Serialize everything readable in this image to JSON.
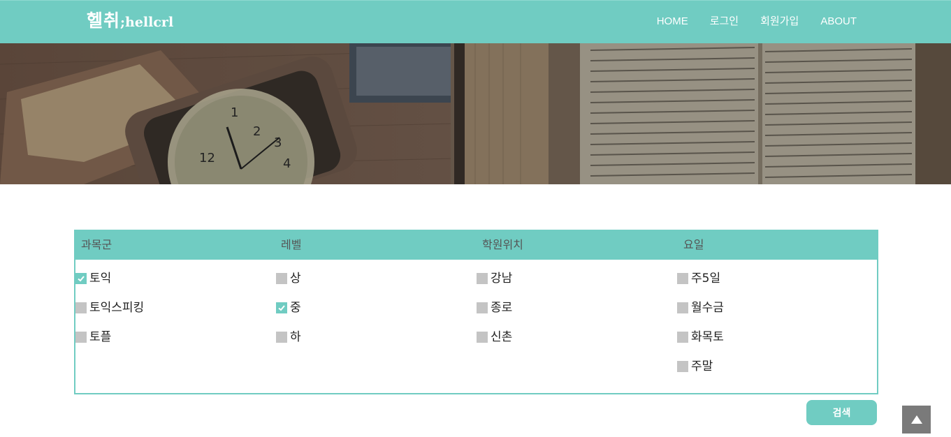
{
  "header": {
    "logo_main": "헬취",
    "logo_sub": ";hellcrl",
    "nav": [
      "HOME",
      "로그인",
      "회원가입",
      "ABOUT"
    ]
  },
  "filter": {
    "columns": [
      {
        "title": "과목군",
        "options": [
          {
            "label": "토익",
            "checked": true
          },
          {
            "label": "토익스피킹",
            "checked": false
          },
          {
            "label": "토플",
            "checked": false
          }
        ]
      },
      {
        "title": "레벨",
        "options": [
          {
            "label": "상",
            "checked": false
          },
          {
            "label": "중",
            "checked": true
          },
          {
            "label": "하",
            "checked": false
          }
        ]
      },
      {
        "title": "학원위치",
        "options": [
          {
            "label": "강남",
            "checked": false
          },
          {
            "label": "종로",
            "checked": false
          },
          {
            "label": "신촌",
            "checked": false
          }
        ]
      },
      {
        "title": "요일",
        "options": [
          {
            "label": "주5일",
            "checked": false
          },
          {
            "label": "월수금",
            "checked": false
          },
          {
            "label": "화목토",
            "checked": false
          },
          {
            "label": "주말",
            "checked": false
          }
        ]
      }
    ]
  },
  "search_button": "검색",
  "colors": {
    "accent": "#70ccc2",
    "unchecked": "#c4c4c4",
    "top_button": "#7a7a7a"
  },
  "icons": {
    "checkbox_checked": "check-icon",
    "scroll_top": "arrow-up-icon"
  }
}
